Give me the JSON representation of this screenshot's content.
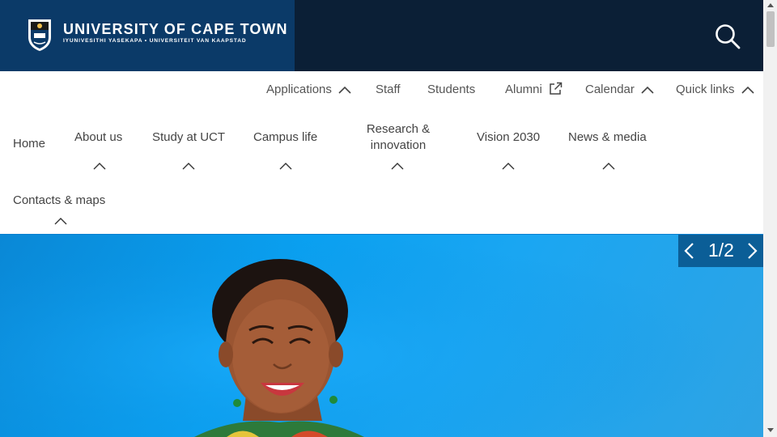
{
  "header": {
    "university_name": "UNIVERSITY OF CAPE TOWN",
    "university_subtitle": "IYUNIVESITHI YASEKAPA • UNIVERSITEIT VAN KAAPSTAD",
    "brand_color": "#0b3a68",
    "bar_color": "#0b1f36"
  },
  "utility_nav": {
    "applications": "Applications",
    "staff": "Staff",
    "students": "Students",
    "alumni": "Alumni",
    "calendar": "Calendar",
    "quick_links": "Quick links"
  },
  "main_nav": {
    "home": "Home",
    "about": "About us",
    "study": "Study at UCT",
    "campus": "Campus life",
    "research_line1": "Research &",
    "research_line2": "innovation",
    "vision": "Vision 2030",
    "news": "News & media",
    "contacts": "Contacts & maps"
  },
  "hero": {
    "slide_counter": "1/2",
    "accent_color": "#0aa0f0"
  },
  "icons": {
    "search": "search-icon",
    "external_link": "external-link-icon",
    "chevron_up": "chevron-up-icon",
    "chevron_left": "chevron-left-icon",
    "chevron_right": "chevron-right-icon"
  }
}
